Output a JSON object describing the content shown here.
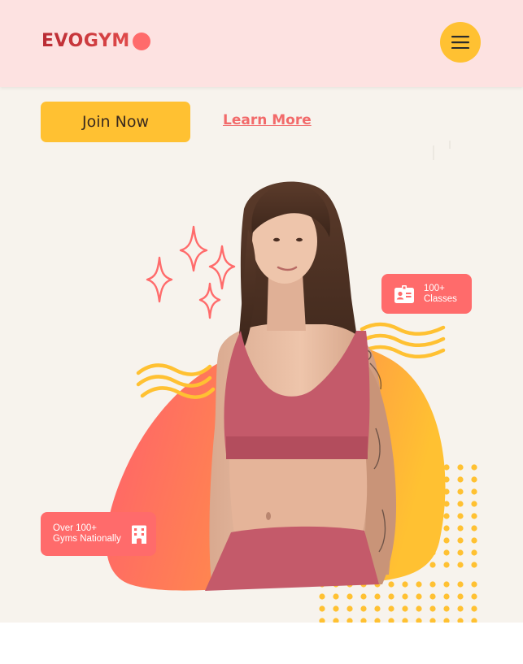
{
  "navbar": {
    "logo_text": "EVOGYM",
    "menu_icon": "hamburger-menu-icon",
    "colors": {
      "background": "#fde2e1",
      "menu_button": "#ffc132",
      "logo": "#c8323a",
      "logo_dot": "#ff6b6b"
    }
  },
  "hero": {
    "join_button_label": "Join Now",
    "learn_more_label": "Learn More",
    "image": "woman-in-pink-sports-bra-photo",
    "badges": {
      "classes": {
        "icon": "id-card-icon",
        "line1": "100+",
        "line2": "Classes"
      },
      "gyms": {
        "icon": "building-icon",
        "line1": "Over 100+",
        "line2": "Gyms Nationally"
      }
    },
    "colors": {
      "background": "#f7f3ed",
      "primary": "#ffc132",
      "accent": "#ff6b6b",
      "link": "#f26a6a"
    }
  }
}
